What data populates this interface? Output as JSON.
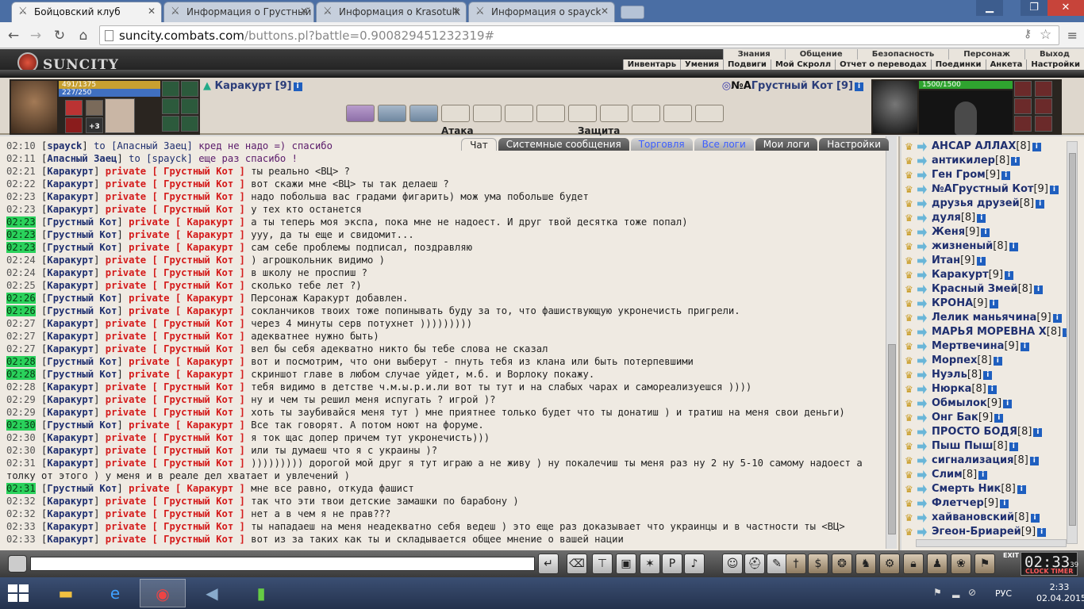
{
  "browser": {
    "tabs": [
      {
        "title": "Бойцовский клуб",
        "active": true
      },
      {
        "title": "Информация о Грустный",
        "active": false
      },
      {
        "title": "Информация о Krasotulk",
        "active": false
      },
      {
        "title": "Информация о spayck",
        "active": false
      }
    ],
    "url_host": "suncity.combats.com",
    "url_path": "/buttons.pl?battle=0.900829451232319#"
  },
  "game": {
    "logo": "SUNCITY",
    "menu_top": [
      "Знания",
      "Общение",
      "Безопасность",
      "Персонаж",
      "Выход"
    ],
    "menu_sub": [
      "Инвентарь",
      "Умения",
      "Подвиги",
      "Мой Скролл",
      "Отчет о переводах",
      "Поединки",
      "Анкета",
      "Настройки"
    ]
  },
  "battle": {
    "left": {
      "name": "Каракурт [9]",
      "hp": "491/1375",
      "mana": "227/250",
      "badge": "+3"
    },
    "right": {
      "name": "Грустный Кот [9]",
      "prefix": "№А",
      "hp": "1500/1500"
    },
    "attack_label": "Атака",
    "defense_label": "Защита"
  },
  "chat_tabs": [
    "Чат",
    "Системные сообщения",
    "Торговля",
    "Все логи",
    "Мои логи",
    "Настройки"
  ],
  "chat": [
    {
      "time": "02:10",
      "hl": false,
      "who": "spayck",
      "kind": "to",
      "target": "Апасный Заец",
      "text": "кред не надо =) спасибо"
    },
    {
      "time": "02:11",
      "hl": false,
      "who": "Апасный Заец",
      "kind": "to",
      "target": "spayck",
      "text": "еще раз спасибо !"
    },
    {
      "time": "02:21",
      "hl": false,
      "who": "Каракурт",
      "kind": "private",
      "target": "Грустный Кот",
      "text": "ты реально <ВЦ> ?"
    },
    {
      "time": "02:22",
      "hl": false,
      "who": "Каракурт",
      "kind": "private",
      "target": "Грустный Кот",
      "text": "вот скажи мне <ВЦ> ты так делаеш ?"
    },
    {
      "time": "02:23",
      "hl": false,
      "who": "Каракурт",
      "kind": "private",
      "target": "Грустный Кот",
      "text": "надо побольша вас градами фигарить) мож ума побольше будет"
    },
    {
      "time": "02:23",
      "hl": false,
      "who": "Каракурт",
      "kind": "private",
      "target": "Грустный Кот",
      "text": "у тех кто останется"
    },
    {
      "time": "02:23",
      "hl": true,
      "who": "Грустный Кот",
      "kind": "private",
      "target": "Каракурт",
      "text": "а ты теперь моя экспа, пока мне не надоест. И друг твой десятка тоже попал)"
    },
    {
      "time": "02:23",
      "hl": true,
      "who": "Грустный Кот",
      "kind": "private",
      "target": "Каракурт",
      "text": "ууу, да ты еще и свидомит..."
    },
    {
      "time": "02:23",
      "hl": true,
      "who": "Грустный Кот",
      "kind": "private",
      "target": "Каракурт",
      "text": "сам себе проблемы подписал, поздравляю"
    },
    {
      "time": "02:24",
      "hl": false,
      "who": "Каракурт",
      "kind": "private",
      "target": "Грустный Кот",
      "text": ") агрошкольник видимо )"
    },
    {
      "time": "02:24",
      "hl": false,
      "who": "Каракурт",
      "kind": "private",
      "target": "Грустный Кот",
      "text": "в школу не проспиш ?"
    },
    {
      "time": "02:25",
      "hl": false,
      "who": "Каракурт",
      "kind": "private",
      "target": "Грустный Кот",
      "text": "сколько тебе лет ?)"
    },
    {
      "time": "02:26",
      "hl": true,
      "who": "Грустный Кот",
      "kind": "private",
      "target": "Каракурт",
      "text": "Персонаж Каракурт добавлен."
    },
    {
      "time": "02:26",
      "hl": true,
      "who": "Грустный Кот",
      "kind": "private",
      "target": "Каракурт",
      "text": "сокланчиков твоих тоже попинывать буду за то, что фашиствующую укронечисть пригрели."
    },
    {
      "time": "02:27",
      "hl": false,
      "who": "Каракурт",
      "kind": "private",
      "target": "Грустный Кот",
      "text": "через 4 минуты серв потухнет )))))))))"
    },
    {
      "time": "02:27",
      "hl": false,
      "who": "Каракурт",
      "kind": "private",
      "target": "Грустный Кот",
      "text": "адекватнее нужно быть)"
    },
    {
      "time": "02:27",
      "hl": false,
      "who": "Каракурт",
      "kind": "private",
      "target": "Грустный Кот",
      "text": "вел бы себя адекватно никто бы тебе слова не сказал"
    },
    {
      "time": "02:28",
      "hl": true,
      "who": "Грустный Кот",
      "kind": "private",
      "target": "Каракурт",
      "text": "вот и посмотрим, что они выберут - пнуть тебя из клана или быть потерпевшими"
    },
    {
      "time": "02:28",
      "hl": true,
      "who": "Грустный Кот",
      "kind": "private",
      "target": "Каракурт",
      "text": "скриншот главе в любом случае уйдет, м.б. и Ворлоку покажу."
    },
    {
      "time": "02:28",
      "hl": false,
      "who": "Каракурт",
      "kind": "private",
      "target": "Грустный Кот",
      "text": "тебя видимо в детстве ч.м.ы.р.и.ли вот ты тут и на слабых чарах и самореализуешся ))))"
    },
    {
      "time": "02:29",
      "hl": false,
      "who": "Каракурт",
      "kind": "private",
      "target": "Грустный Кот",
      "text": "ну и чем ты решил меня испугать ? игрой )?"
    },
    {
      "time": "02:29",
      "hl": false,
      "who": "Каракурт",
      "kind": "private",
      "target": "Грустный Кот",
      "text": "хоть ты заубивайся меня тут ) мне приятнее только будет что ты донатиш ) и тратиш на меня свои деньги)"
    },
    {
      "time": "02:30",
      "hl": true,
      "who": "Грустный Кот",
      "kind": "private",
      "target": "Каракурт",
      "text": "Все так говорят. А потом ноют на форуме."
    },
    {
      "time": "02:30",
      "hl": false,
      "who": "Каракурт",
      "kind": "private",
      "target": "Грустный Кот",
      "text": "я ток щас допер причем тут укронечисть)))"
    },
    {
      "time": "02:30",
      "hl": false,
      "who": "Каракурт",
      "kind": "private",
      "target": "Грустный Кот",
      "text": "или ты думаеш что я с украины )?"
    },
    {
      "time": "02:31",
      "hl": false,
      "who": "Каракурт",
      "kind": "private",
      "target": "Грустный Кот",
      "text": "))))))))) дорогой мой друг я тут играю а не живу ) ну покалечиш ты меня раз ну 2 ну 5-10 самому надоест а толку от этого ) у меня и в реале дел хватает и увлечений )",
      "wrap": true
    },
    {
      "time": "02:31",
      "hl": true,
      "who": "Грустный Кот",
      "kind": "private",
      "target": "Каракурт",
      "text": "мне все равно, откуда фашист"
    },
    {
      "time": "02:32",
      "hl": false,
      "who": "Каракурт",
      "kind": "private",
      "target": "Грустный Кот",
      "text": "так что эти твои детские замашки по барабону )"
    },
    {
      "time": "02:32",
      "hl": false,
      "who": "Каракурт",
      "kind": "private",
      "target": "Грустный Кот",
      "text": "нет а в чем я не прав???"
    },
    {
      "time": "02:33",
      "hl": false,
      "who": "Каракурт",
      "kind": "private",
      "target": "Грустный Кот",
      "text": "ты нападаеш на меня неадекватно себя ведеш ) это еще раз доказывает что украинцы и в частности ты <ВЦ>"
    },
    {
      "time": "02:33",
      "hl": false,
      "who": "Каракурт",
      "kind": "private",
      "target": "Грустный Кот",
      "text": "вот из за таких как ты и складывается общее мнение о вашей нации"
    }
  ],
  "private_word": "private",
  "users": [
    {
      "name": "АНСАР АЛЛАХ",
      "lvl": "[8]"
    },
    {
      "name": "антикилер",
      "lvl": "[8]"
    },
    {
      "name": "Ген Гром",
      "lvl": "[9]"
    },
    {
      "name": "№АГрустный Кот",
      "lvl": "[9]"
    },
    {
      "name": "друзья друзей",
      "lvl": "[8]"
    },
    {
      "name": "дуля",
      "lvl": "[8]"
    },
    {
      "name": "Женя",
      "lvl": "[9]"
    },
    {
      "name": "жизненый",
      "lvl": "[8]"
    },
    {
      "name": "Итан",
      "lvl": "[9]"
    },
    {
      "name": "Каракурт",
      "lvl": "[9]"
    },
    {
      "name": "Красный Змей",
      "lvl": "[8]"
    },
    {
      "name": "КРОНА",
      "lvl": "[9]"
    },
    {
      "name": "Лелик маньячина",
      "lvl": "[9]"
    },
    {
      "name": "МАРЬЯ МОРЕВНА Х",
      "lvl": "[8]"
    },
    {
      "name": "Мертвечина",
      "lvl": "[9]"
    },
    {
      "name": "Морпех",
      "lvl": "[8]"
    },
    {
      "name": "Нуэль",
      "lvl": "[8]"
    },
    {
      "name": "Нюрка",
      "lvl": "[8]"
    },
    {
      "name": "Обмылок",
      "lvl": "[9]"
    },
    {
      "name": "Онг Бак",
      "lvl": "[9]"
    },
    {
      "name": "ПРОСТО БОДЯ",
      "lvl": "[8]"
    },
    {
      "name": "Пыш Пыш",
      "lvl": "[8]"
    },
    {
      "name": "сигнализация",
      "lvl": "[8]"
    },
    {
      "name": "Слим",
      "lvl": "[8]"
    },
    {
      "name": "Смерть Ник",
      "lvl": "[8]"
    },
    {
      "name": "Флетчер",
      "lvl": "[9]"
    },
    {
      "name": "хайвановский",
      "lvl": "[8]"
    },
    {
      "name": "Эгеон-Бриарей",
      "lvl": "[9]"
    }
  ],
  "clock": {
    "time": "02:33",
    "sec": "39",
    "label": "CLOCK TIMER",
    "exit": "EXIT"
  },
  "taskbar": {
    "lang": "РУС",
    "time": "2:33",
    "date": "02.04.2015"
  }
}
